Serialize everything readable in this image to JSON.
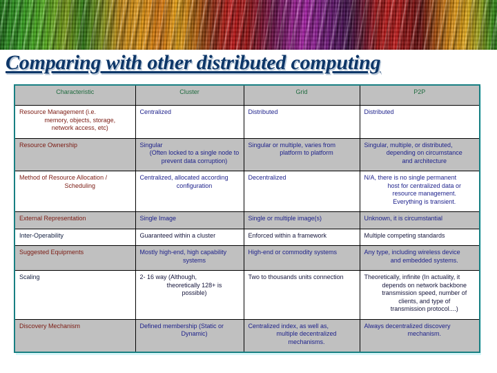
{
  "slide": {
    "title": "Comparing with other distributed computing",
    "title_color": "#0d3668",
    "banner_colors": [
      "#2f9b1e",
      "#e79a12",
      "#c21616",
      "#a41ea4",
      "#6a0d0d",
      "#d88a10",
      "#3d8c16"
    ],
    "table_border_color": "#177f82",
    "header_bg": "#c0c0c0",
    "header_text_color": "#1f6b3f",
    "col1_text_color": "#7b1a12",
    "data_text_color": "#1b1f8a"
  },
  "table": {
    "columns": [
      "Characteristic",
      "Cluster",
      "Grid",
      "P2P"
    ],
    "rows": [
      {
        "shaded": false,
        "characteristic": [
          "Resource Management (i.e.",
          "memory, objects, storage,",
          "network access, etc)"
        ],
        "cluster": [
          "Centralized"
        ],
        "grid": [
          "Distributed"
        ],
        "p2p": [
          "Distributed"
        ]
      },
      {
        "shaded": true,
        "characteristic": [
          "Resource Ownership"
        ],
        "cluster": [
          "Singular",
          "(Often locked to a single node to",
          "prevent data corruption)"
        ],
        "grid": [
          "Singular or multiple, varies from",
          "platform to platform"
        ],
        "p2p": [
          "Singular, multiple, or distributed,",
          "depending on circumstance",
          "and architecture"
        ]
      },
      {
        "shaded": false,
        "characteristic": [
          "Method of Resource Allocation /",
          "Scheduling"
        ],
        "cluster": [
          "Centralized, allocated according",
          "configuration"
        ],
        "grid": [
          "Decentralized"
        ],
        "p2p": [
          "N/A, there is no single permanent",
          "host for centralized data or",
          "resource management.",
          "Everything is transient."
        ]
      },
      {
        "shaded": true,
        "characteristic": [
          "External Representation"
        ],
        "cluster": [
          "Single Image"
        ],
        "grid": [
          "Single or multiple image(s)"
        ],
        "p2p": [
          "Unknown, it is circumstantial"
        ]
      },
      {
        "shaded": false,
        "dark": true,
        "characteristic": [
          "Inter-Operability"
        ],
        "cluster": [
          "Guaranteed within a cluster"
        ],
        "grid": [
          "Enforced within a framework"
        ],
        "p2p": [
          "Multiple competing standards"
        ]
      },
      {
        "shaded": true,
        "characteristic": [
          "Suggested Equipments"
        ],
        "cluster": [
          "Mostly high-end, high capability",
          "systems"
        ],
        "grid": [
          "High-end or commodity systems"
        ],
        "p2p": [
          "Any type, including wireless device",
          "and embedded systems."
        ]
      },
      {
        "shaded": false,
        "dark": true,
        "characteristic": [
          "Scaling"
        ],
        "cluster": [
          "2- 16 way (Although,",
          "theoretically 128+ is",
          "possible)"
        ],
        "grid": [
          "Two to thousands units connection"
        ],
        "p2p": [
          "Theoretically, infinite (In actuality, it",
          "depends on network backbone",
          "transmission speed, number of",
          "clients, and type of",
          "transmission protocol....)"
        ]
      },
      {
        "shaded": true,
        "characteristic": [
          "Discovery Mechanism"
        ],
        "cluster": [
          "Defined membership (Static or",
          "Dynamic)"
        ],
        "grid": [
          "Centralized index, as well as,",
          "multiple decentralized",
          "mechanisms."
        ],
        "p2p": [
          "Always decentralized discovery",
          "mechanism."
        ]
      }
    ]
  }
}
